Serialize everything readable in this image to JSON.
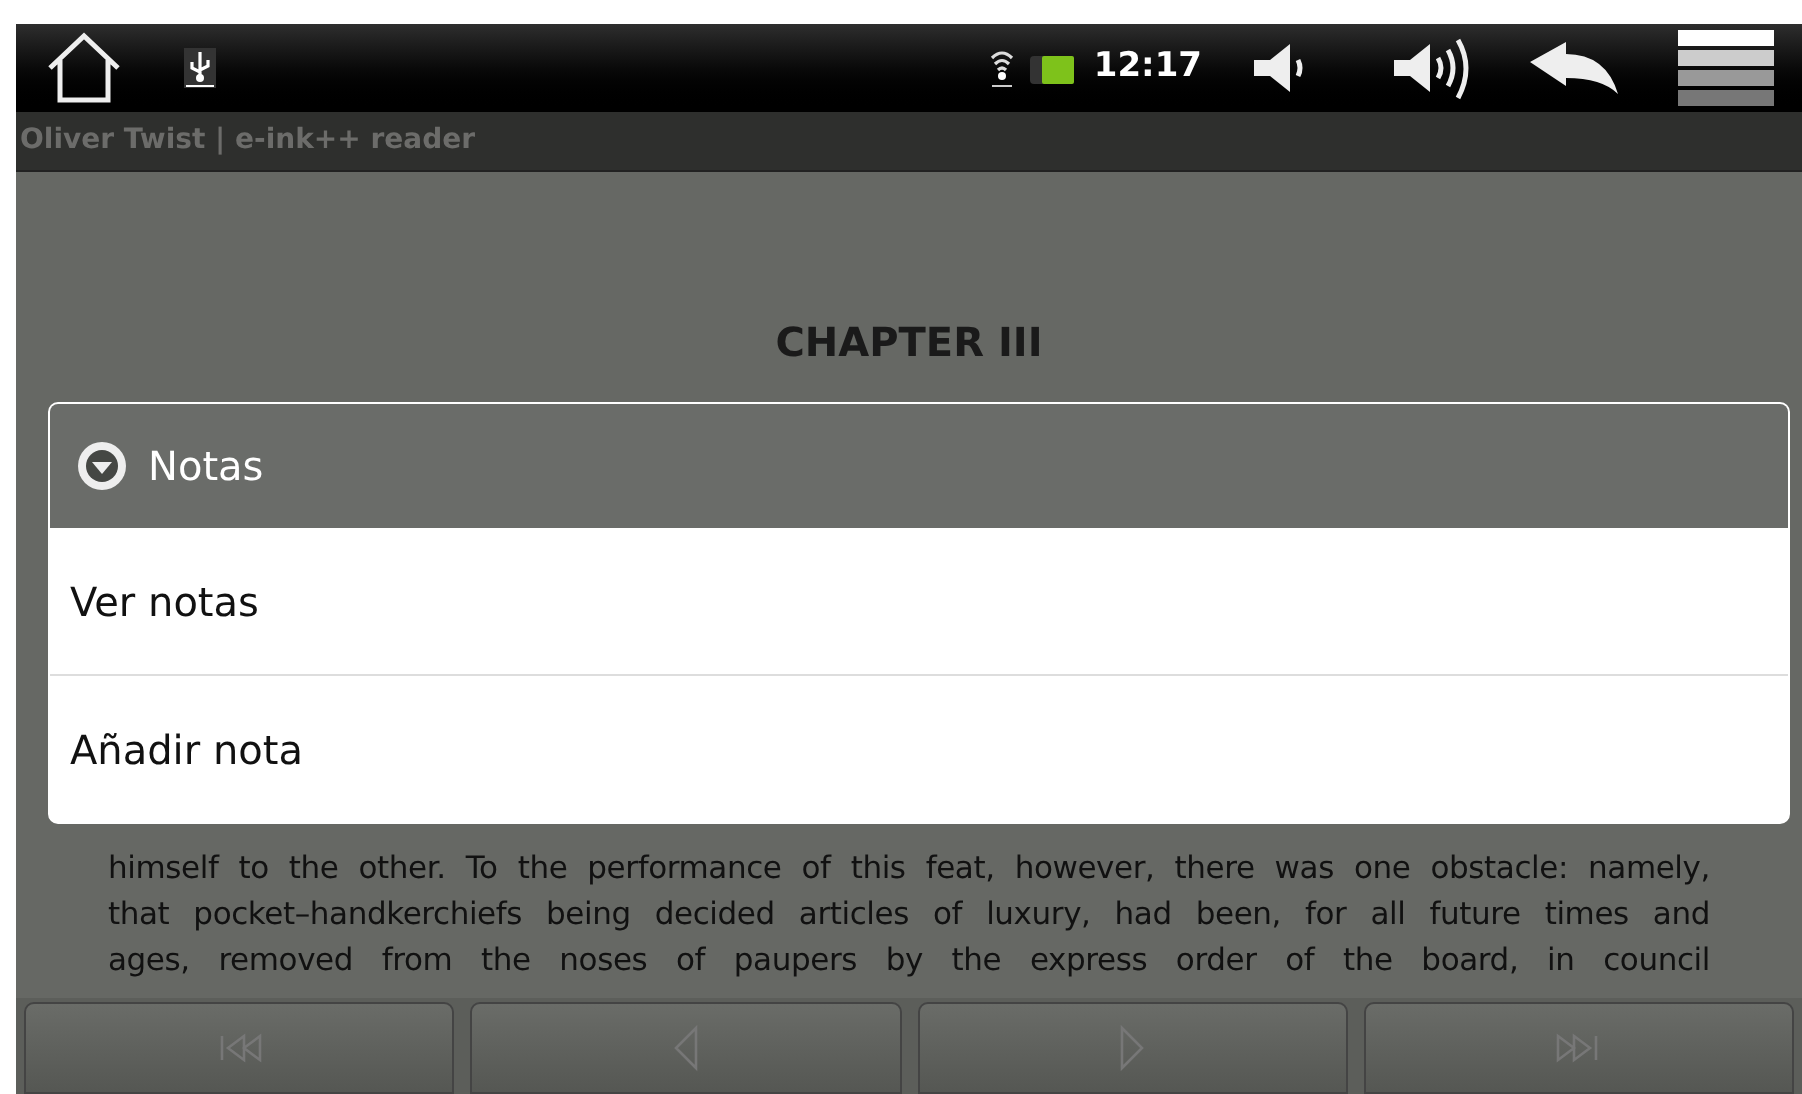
{
  "status_bar": {
    "time": "12:17"
  },
  "title_bar": {
    "title": "Oliver Twist | e-ink++ reader"
  },
  "book": {
    "chapter": "CHAPTER III",
    "lines": [
      "himself to the other. To the performance of this feat, however, there was one obstacle: namely,",
      "that pocket–handkerchiefs being decided articles of luxury, had been, for all future times and",
      "ages, removed from the noses of paupers by the express order of the board, in council"
    ]
  },
  "dialog": {
    "title": "Notas",
    "items": [
      {
        "label": "Ver notas"
      },
      {
        "label": "Añadir nota"
      }
    ]
  }
}
